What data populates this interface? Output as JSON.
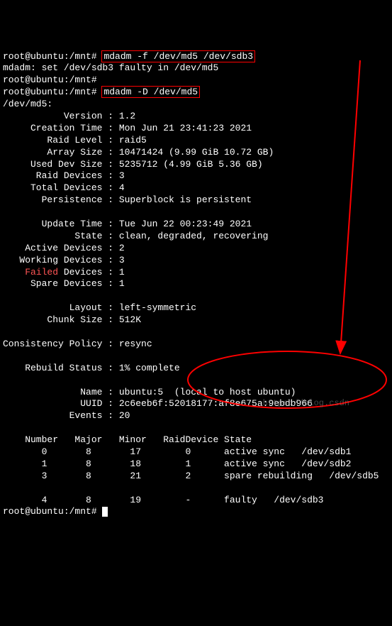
{
  "lines": {
    "prompt1_host": "root@ubuntu:/mnt#",
    "cmd1": "mdadm -f /dev/md5 /dev/sdb3",
    "out1": "mdadm: set /dev/sdb3 faulty in /dev/md5",
    "prompt2_host": "root@ubuntu:/mnt#",
    "prompt3_host": "root@ubuntu:/mnt#",
    "cmd2": "mdadm -D /dev/md5",
    "device": "/dev/md5:",
    "version": "           Version : 1.2",
    "creation_time": "     Creation Time : Mon Jun 21 23:41:23 2021",
    "raid_level": "        Raid Level : raid5",
    "array_size": "        Array Size : 10471424 (9.99 GiB 10.72 GB)",
    "used_dev_size": "     Used Dev Size : 5235712 (4.99 GiB 5.36 GB)",
    "raid_devices": "      Raid Devices : 3",
    "total_devices": "     Total Devices : 4",
    "persistence": "       Persistence : Superblock is persistent",
    "update_time": "       Update Time : Tue Jun 22 00:23:49 2021",
    "state": "             State : clean, degraded, recovering",
    "active_devices": "    Active Devices : 2",
    "working_devices": "   Working Devices : 3",
    "failed_label": "Failed",
    "failed_rest": " Devices : 1",
    "spare_devices": "     Spare Devices : 1",
    "layout": "            Layout : left-symmetric",
    "chunk_size": "        Chunk Size : 512K",
    "consistency": "Consistency Policy : resync",
    "rebuild_status": "    Rebuild Status : 1% complete",
    "name": "              Name : ubuntu:5  (local to host ubuntu)",
    "uuid": "              UUID : 2c6eeb6f:52018177:af8e675a:9ebdb966",
    "events": "            Events : 20",
    "table_header": "    Number   Major   Minor   RaidDevice State",
    "row0": "       0       8       17        0      active sync   /dev/sdb1",
    "row1": "       1       8       18        1      active sync   /dev/sdb2",
    "row2": "       3       8       21        2      spare rebuilding   /dev/sdb5",
    "row4": "       4       8       19        -      faulty   /dev/sdb3",
    "prompt4_host": "root@ubuntu:/mnt#"
  },
  "watermark": "https://blog.csdn"
}
